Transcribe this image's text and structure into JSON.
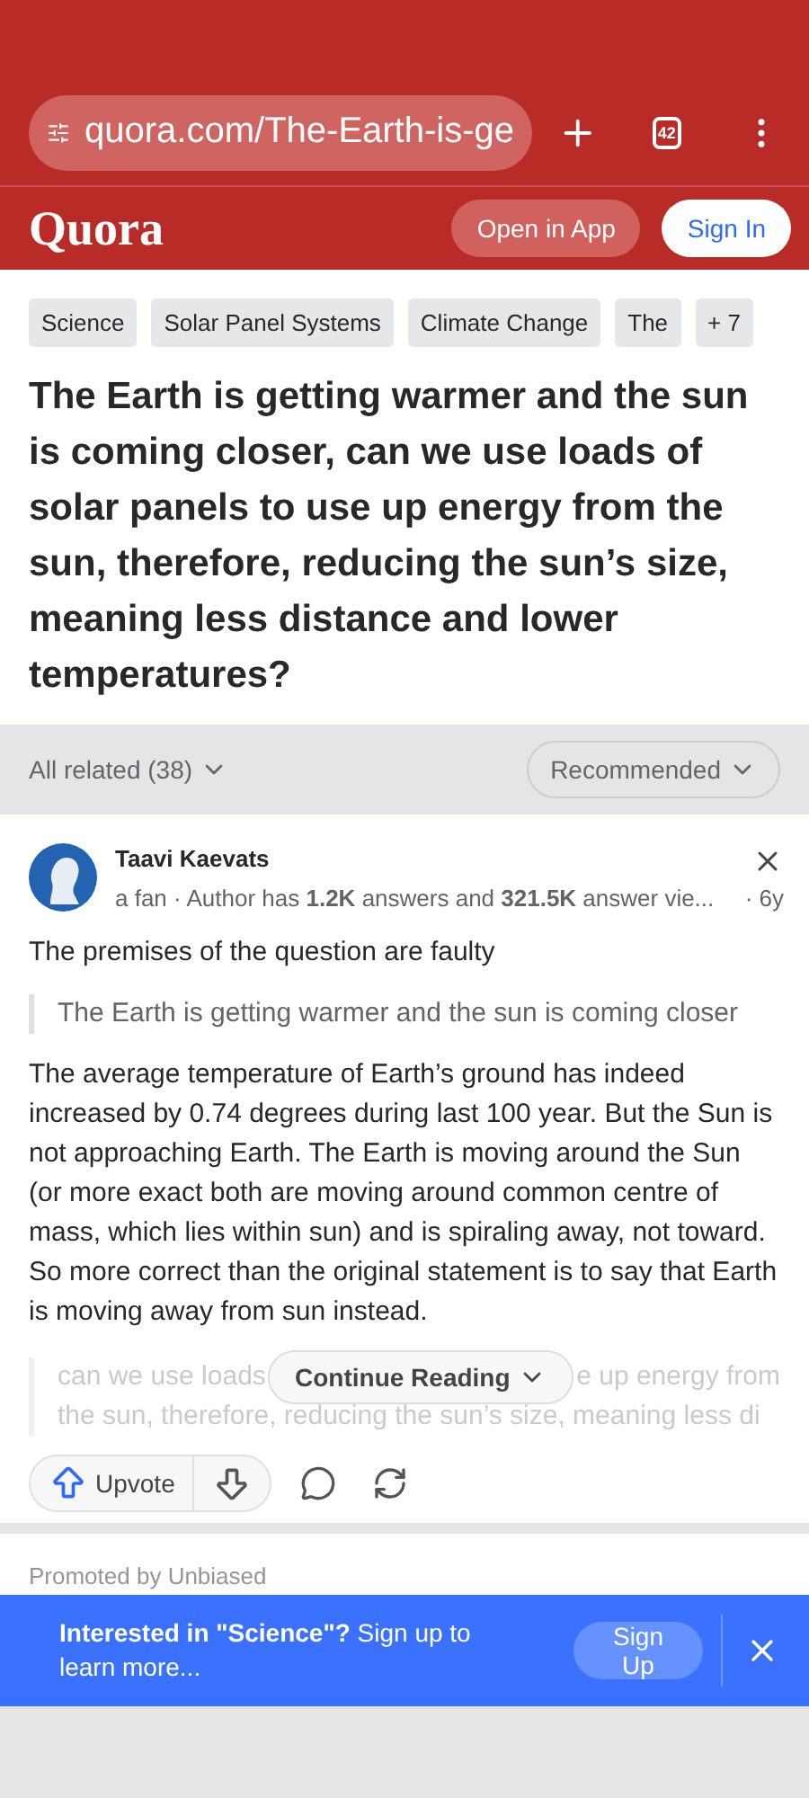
{
  "browser": {
    "url": "quora.com/The-Earth-is-ge",
    "tab_count": "42"
  },
  "header": {
    "logo": "Quora",
    "open_app": "Open in App",
    "sign_in": "Sign In"
  },
  "topics": [
    {
      "label": "Science"
    },
    {
      "label": "Solar Panel Systems"
    },
    {
      "label": "Climate Change"
    },
    {
      "label": "The"
    }
  ],
  "more_topics": "+ 7",
  "question": "The Earth is getting warmer and the sun is coming closer, can we use loads of solar panels to use up energy from the sun, therefore, reducing the sun’s size, meaning less distance and lower temperatures?",
  "filter": {
    "related": "All related (38)",
    "sort": "Recommended"
  },
  "answer": {
    "author": "Taavi Kaevats",
    "meta": "a fan · Author has **1.2K** answers and **321.5K** answer vie...",
    "age": "· 6y",
    "lead": "The premises of the question are faulty",
    "quote": "The Earth is getting warmer and the sun is coming closer",
    "body": "The average temperature of Earth’s ground has indeed increased by 0.74 degrees during last 100 year. But the Sun is not approaching Earth. The Earth is moving around the Sun (or more exact both are moving around common centre of mass, which lies within sun) and is spiraling away, not toward. So more correct than the original statement is to say that Earth is moving away from sun instead.",
    "faded_quote": [
      "can we use loads",
      "e up energy from",
      "the sun, therefore, reducing the sun’s size, meaning less di"
    ],
    "continue": "Continue Reading",
    "upvote": "Upvote"
  },
  "promoted": "Promoted by Unbiased",
  "banner": {
    "text": "**Interested in \"Science\"?** Sign up to learn more...",
    "button": "Sign Up"
  }
}
